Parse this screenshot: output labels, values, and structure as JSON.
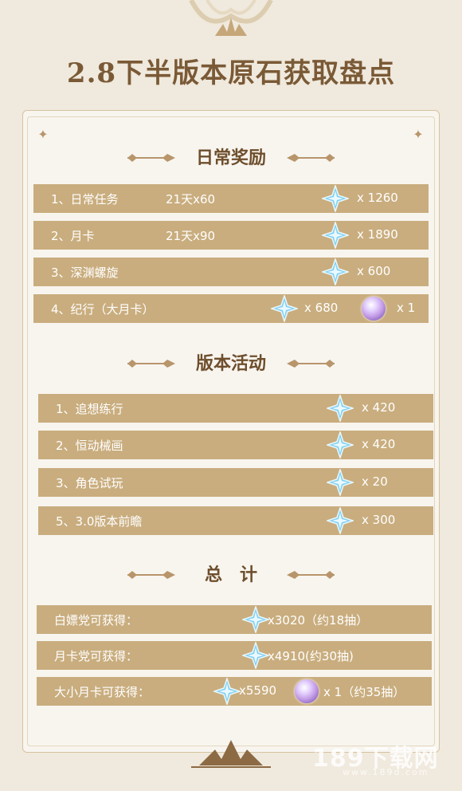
{
  "title": "2.8下半版本原石获取盘点",
  "sections": {
    "daily": {
      "title": "日常奖励",
      "rows": [
        {
          "label": "1、日常任务",
          "detail": "21天x60",
          "qty": "x  1260"
        },
        {
          "label": "2、月卡",
          "detail": "21天x90",
          "qty": "x  1890"
        },
        {
          "label": "3、深渊螺旋",
          "detail": "",
          "qty": "x  600"
        },
        {
          "label": "4、纪行（大月卡）",
          "detail": "",
          "qty": "x  680",
          "qty2": "x  1"
        }
      ]
    },
    "events": {
      "title": "版本活动",
      "rows": [
        {
          "label": "1、追想练行",
          "qty": "x  420"
        },
        {
          "label": "2、恒动械画",
          "qty": "x  420"
        },
        {
          "label": "3、角色试玩",
          "qty": "x  20"
        },
        {
          "label": "5、3.0版本前瞻",
          "qty": "x  300"
        }
      ]
    },
    "total": {
      "title": "总　计",
      "rows": [
        {
          "label": "白嫖党可获得：",
          "qty": "x3020（约18抽）"
        },
        {
          "label": "月卡党可获得：",
          "qty": "x4910(约30抽)"
        },
        {
          "label": "大小月卡可获得：",
          "qty": "x5590",
          "qty2": "x 1（约35抽）"
        }
      ]
    }
  },
  "watermark": {
    "main": "189下载网",
    "sub": "www.189d.com"
  },
  "colors": {
    "bar": "#c9ad7e",
    "title": "#7a5a36",
    "background": "#f0e9dd"
  },
  "icons": [
    "primogem-icon",
    "intertwined-fate-icon"
  ]
}
